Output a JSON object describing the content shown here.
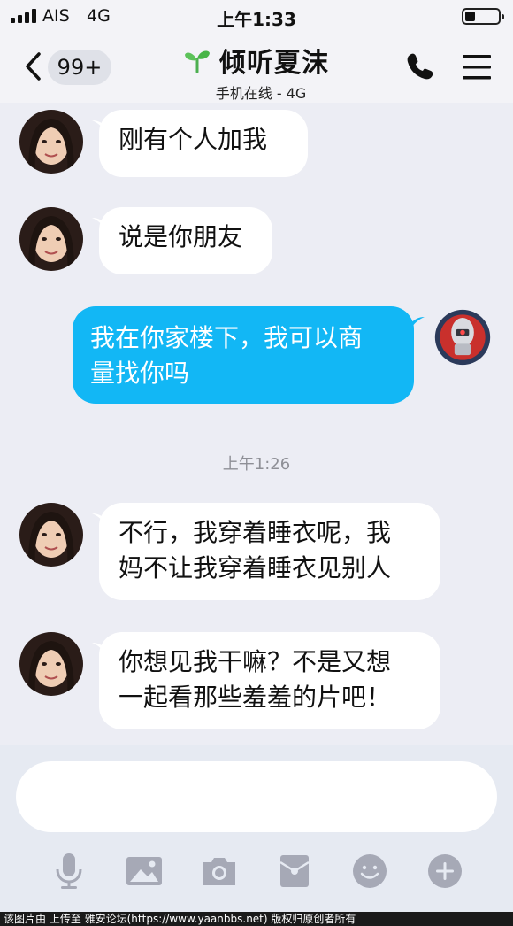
{
  "status_bar": {
    "carrier": "AIS",
    "network": "4G",
    "time": "上午1:33",
    "battery_level": 0.3
  },
  "nav": {
    "unread_badge": "99+",
    "contact_name": "倾听夏沫",
    "contact_status": "手机在线 - 4G",
    "icons": [
      "back-chevron-icon",
      "sprout-icon",
      "phone-icon",
      "menu-icon"
    ]
  },
  "messages": [
    {
      "direction": "incoming",
      "lines": [
        "刚有个人加我"
      ]
    },
    {
      "direction": "incoming",
      "lines": [
        "说是你朋友"
      ]
    },
    {
      "direction": "outgoing",
      "lines": [
        "我在你家楼下，我可以商",
        "量找你吗"
      ]
    },
    {
      "direction": "incoming",
      "lines": [
        "不行，我穿着睡衣呢，我",
        "妈不让我穿着睡衣见别人"
      ]
    },
    {
      "direction": "incoming",
      "lines": [
        "你想见我干嘛？不是又想",
        "一起看那些羞羞的片吧！"
      ]
    }
  ],
  "time_divider": "上午1:26",
  "input": {
    "value": "",
    "placeholder": ""
  },
  "toolbar": {
    "icons": [
      "microphone-icon",
      "picture-icon",
      "camera-icon",
      "red-packet-icon",
      "emoji-icon",
      "plus-icon"
    ]
  },
  "watermark": "该图片由  上传至 雅安论坛(https://www.yaanbbs.net) 版权归原创者所有",
  "colors": {
    "outgoing_bubble": "#12b7f5",
    "incoming_bubble": "#ffffff",
    "background": "#ecedf4",
    "icon_gray": "#a6a9b6"
  }
}
